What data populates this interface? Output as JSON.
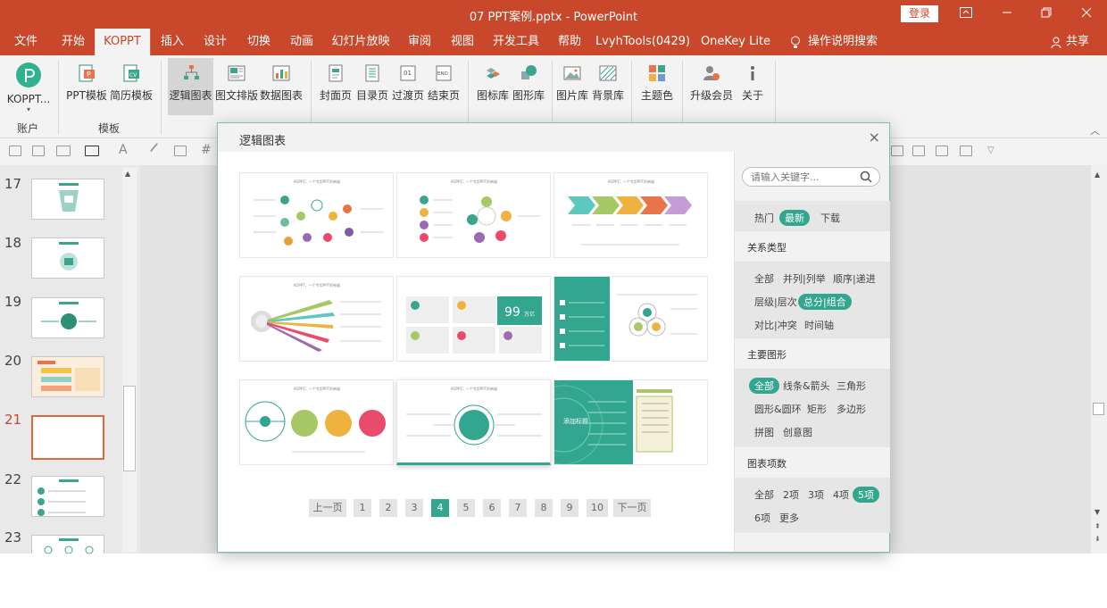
{
  "window": {
    "title": "07  PPT案例.pptx  -  PowerPoint",
    "login": "登录"
  },
  "menu": [
    "文件",
    "开始",
    "KOPPT",
    "插入",
    "设计",
    "切换",
    "动画",
    "幻灯片放映",
    "审阅",
    "视图",
    "开发工具",
    "帮助",
    "LvyhTools(0429)",
    "OneKey Lite",
    "操作说明搜索",
    "共享"
  ],
  "ribbon": {
    "buttons": [
      "KOPPT...",
      "PPT模板",
      "简历模板",
      "逻辑图表",
      "图文排版",
      "数据图表",
      "封面页",
      "目录页",
      "过渡页",
      "结束页",
      "图标库",
      "图形库",
      "图片库",
      "背景库",
      "主题色",
      "升级会员",
      "关于"
    ],
    "groups": [
      "账户",
      "模板"
    ]
  },
  "slides": {
    "numbers": [
      "17",
      "18",
      "19",
      "20",
      "21",
      "22",
      "23"
    ],
    "current": "21"
  },
  "dialog": {
    "title": "逻辑图表",
    "close": "×",
    "template_header": "KOPPT，一个专用PPT的神器",
    "templates": [
      {
        "id": "t1",
        "color": "#3aa58f"
      },
      {
        "id": "t2",
        "color": "#3aa58f"
      },
      {
        "id": "t3",
        "color": "#e8a03a"
      },
      {
        "id": "t4",
        "color": "#e94b6a"
      },
      {
        "id": "t5",
        "color": "#33a68f",
        "text": "99",
        "sub": "万亿"
      },
      {
        "id": "t6",
        "color": "#33a68f"
      },
      {
        "id": "t7",
        "color": "#a7c864"
      },
      {
        "id": "t8",
        "color": "#33a68f"
      },
      {
        "id": "t9",
        "color": "#33a68f",
        "text": "添加标题"
      }
    ],
    "pagination": {
      "prev": "上一页",
      "pages": [
        "1",
        "2",
        "3",
        "4",
        "5",
        "6",
        "7",
        "8",
        "9",
        "10"
      ],
      "current": "4",
      "next": "下一页"
    },
    "filter": {
      "search_placeholder": "请输入关键字...",
      "sort": [
        "热门",
        "最新",
        "下载"
      ],
      "sort_active": "最新",
      "sections": [
        {
          "title": "关系类型",
          "items": [
            "全部",
            "并列|列举",
            "顺序|递进",
            "层级|层次",
            "总分|组合",
            "对比|冲突",
            "时间轴"
          ],
          "active": "总分|组合"
        },
        {
          "title": "主要图形",
          "items": [
            "全部",
            "线条&箭头",
            "三角形",
            "圆形&圆环",
            "矩形",
            "多边形",
            "拼图",
            "创意图"
          ],
          "active": "全部"
        },
        {
          "title": "图表项数",
          "items": [
            "全部",
            "2项",
            "3项",
            "4项",
            "5项",
            "6项",
            "更多"
          ],
          "active": "5项"
        }
      ]
    }
  },
  "colors": {
    "brand": "#c9472a",
    "accent": "#33a68f"
  }
}
